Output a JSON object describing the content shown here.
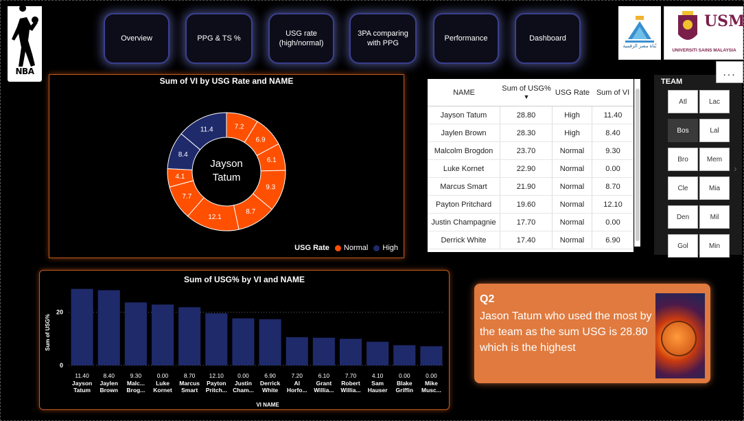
{
  "nav": {
    "buttons": [
      "Overview",
      "PPG & TS %",
      "USG rate (high/normal)",
      "3PA comparing with PPG",
      "Performance",
      "Dashboard"
    ]
  },
  "logos": {
    "nba": "NBA",
    "egypt_caption": "بُناة مصر الرقمية",
    "usm_mark": "USM",
    "usm_caption": "UNIVERSITI SAINS MALAYSIA"
  },
  "donut": {
    "title": "Sum of VI by USG Rate and NAME",
    "center_label_line1": "Jayson",
    "center_label_line2": "Tatum",
    "legend_title": "USG Rate",
    "legend_items": [
      "Normal",
      "High"
    ],
    "colors": {
      "Normal": "#fe5000",
      "High": "#1f2a6b"
    }
  },
  "chart_data": [
    {
      "type": "pie",
      "title": "Sum of VI by USG Rate and NAME",
      "legend_title": "USG Rate",
      "slices": [
        {
          "value": 7.2,
          "category": "Normal"
        },
        {
          "value": 6.9,
          "category": "Normal"
        },
        {
          "value": 6.1,
          "category": "Normal"
        },
        {
          "value": 9.3,
          "category": "Normal"
        },
        {
          "value": 8.7,
          "category": "Normal"
        },
        {
          "value": 12.1,
          "category": "Normal"
        },
        {
          "value": 7.7,
          "category": "Normal"
        },
        {
          "value": 4.1,
          "category": "Normal"
        },
        {
          "value": 8.4,
          "category": "High"
        },
        {
          "value": 11.4,
          "category": "High"
        }
      ]
    },
    {
      "type": "bar",
      "title": "Sum of USG% by VI and NAME",
      "xlabel": "VI NAME",
      "ylabel": "Sum of USG%",
      "ylim": [
        0,
        30
      ],
      "yticks": [
        0,
        20
      ],
      "categories": [
        {
          "vi": "11.40",
          "name": "Jayson Tatum"
        },
        {
          "vi": "8.40",
          "name": "Jaylen Brown"
        },
        {
          "vi": "9.30",
          "name": "Malc... Brog..."
        },
        {
          "vi": "0.00",
          "name": "Luke Kornet"
        },
        {
          "vi": "8.70",
          "name": "Marcus Smart"
        },
        {
          "vi": "12.10",
          "name": "Payton Pritch..."
        },
        {
          "vi": "0.00",
          "name": "Justin Cham..."
        },
        {
          "vi": "6.90",
          "name": "Derrick White"
        },
        {
          "vi": "7.20",
          "name": "Al Horfo..."
        },
        {
          "vi": "6.10",
          "name": "Grant Willia..."
        },
        {
          "vi": "7.70",
          "name": "Robert Willia..."
        },
        {
          "vi": "4.10",
          "name": "Sam Hauser"
        },
        {
          "vi": "0.00",
          "name": "Blake Griffin"
        },
        {
          "vi": "0.00",
          "name": "Mike Musc..."
        }
      ],
      "values": [
        28.8,
        28.3,
        23.7,
        22.9,
        21.9,
        19.6,
        17.7,
        17.4,
        10.6,
        10.4,
        10.0,
        8.9,
        7.6,
        7.2
      ],
      "color": "#1f2a6b"
    }
  ],
  "table": {
    "headers": [
      "NAME",
      "Sum of USG%",
      "USG Rate",
      "Sum of VI"
    ],
    "rows": [
      [
        "Jayson Tatum",
        "28.80",
        "High",
        "11.40"
      ],
      [
        "Jaylen Brown",
        "28.30",
        "High",
        "8.40"
      ],
      [
        "Malcolm Brogdon",
        "23.70",
        "Normal",
        "9.30"
      ],
      [
        "Luke Kornet",
        "22.90",
        "Normal",
        "0.00"
      ],
      [
        "Marcus Smart",
        "21.90",
        "Normal",
        "8.70"
      ],
      [
        "Payton Pritchard",
        "19.60",
        "Normal",
        "12.10"
      ],
      [
        "Justin Champagnie",
        "17.70",
        "Normal",
        "0.00"
      ],
      [
        "Derrick White",
        "17.40",
        "Normal",
        "6.90"
      ]
    ]
  },
  "team_slicer": {
    "title": "TEAM",
    "options": [
      "Atl",
      "Lac",
      "Bos",
      "Lal",
      "Bro",
      "Mem",
      "Cle",
      "Mia",
      "Den",
      "Mil",
      "Gol",
      "Min"
    ],
    "selected": "Bos",
    "more_label": "..."
  },
  "q_card": {
    "title": "Q2",
    "text": "Jason Tatum who used the most by the team as the sum USG is 28.80 which is the highest"
  }
}
